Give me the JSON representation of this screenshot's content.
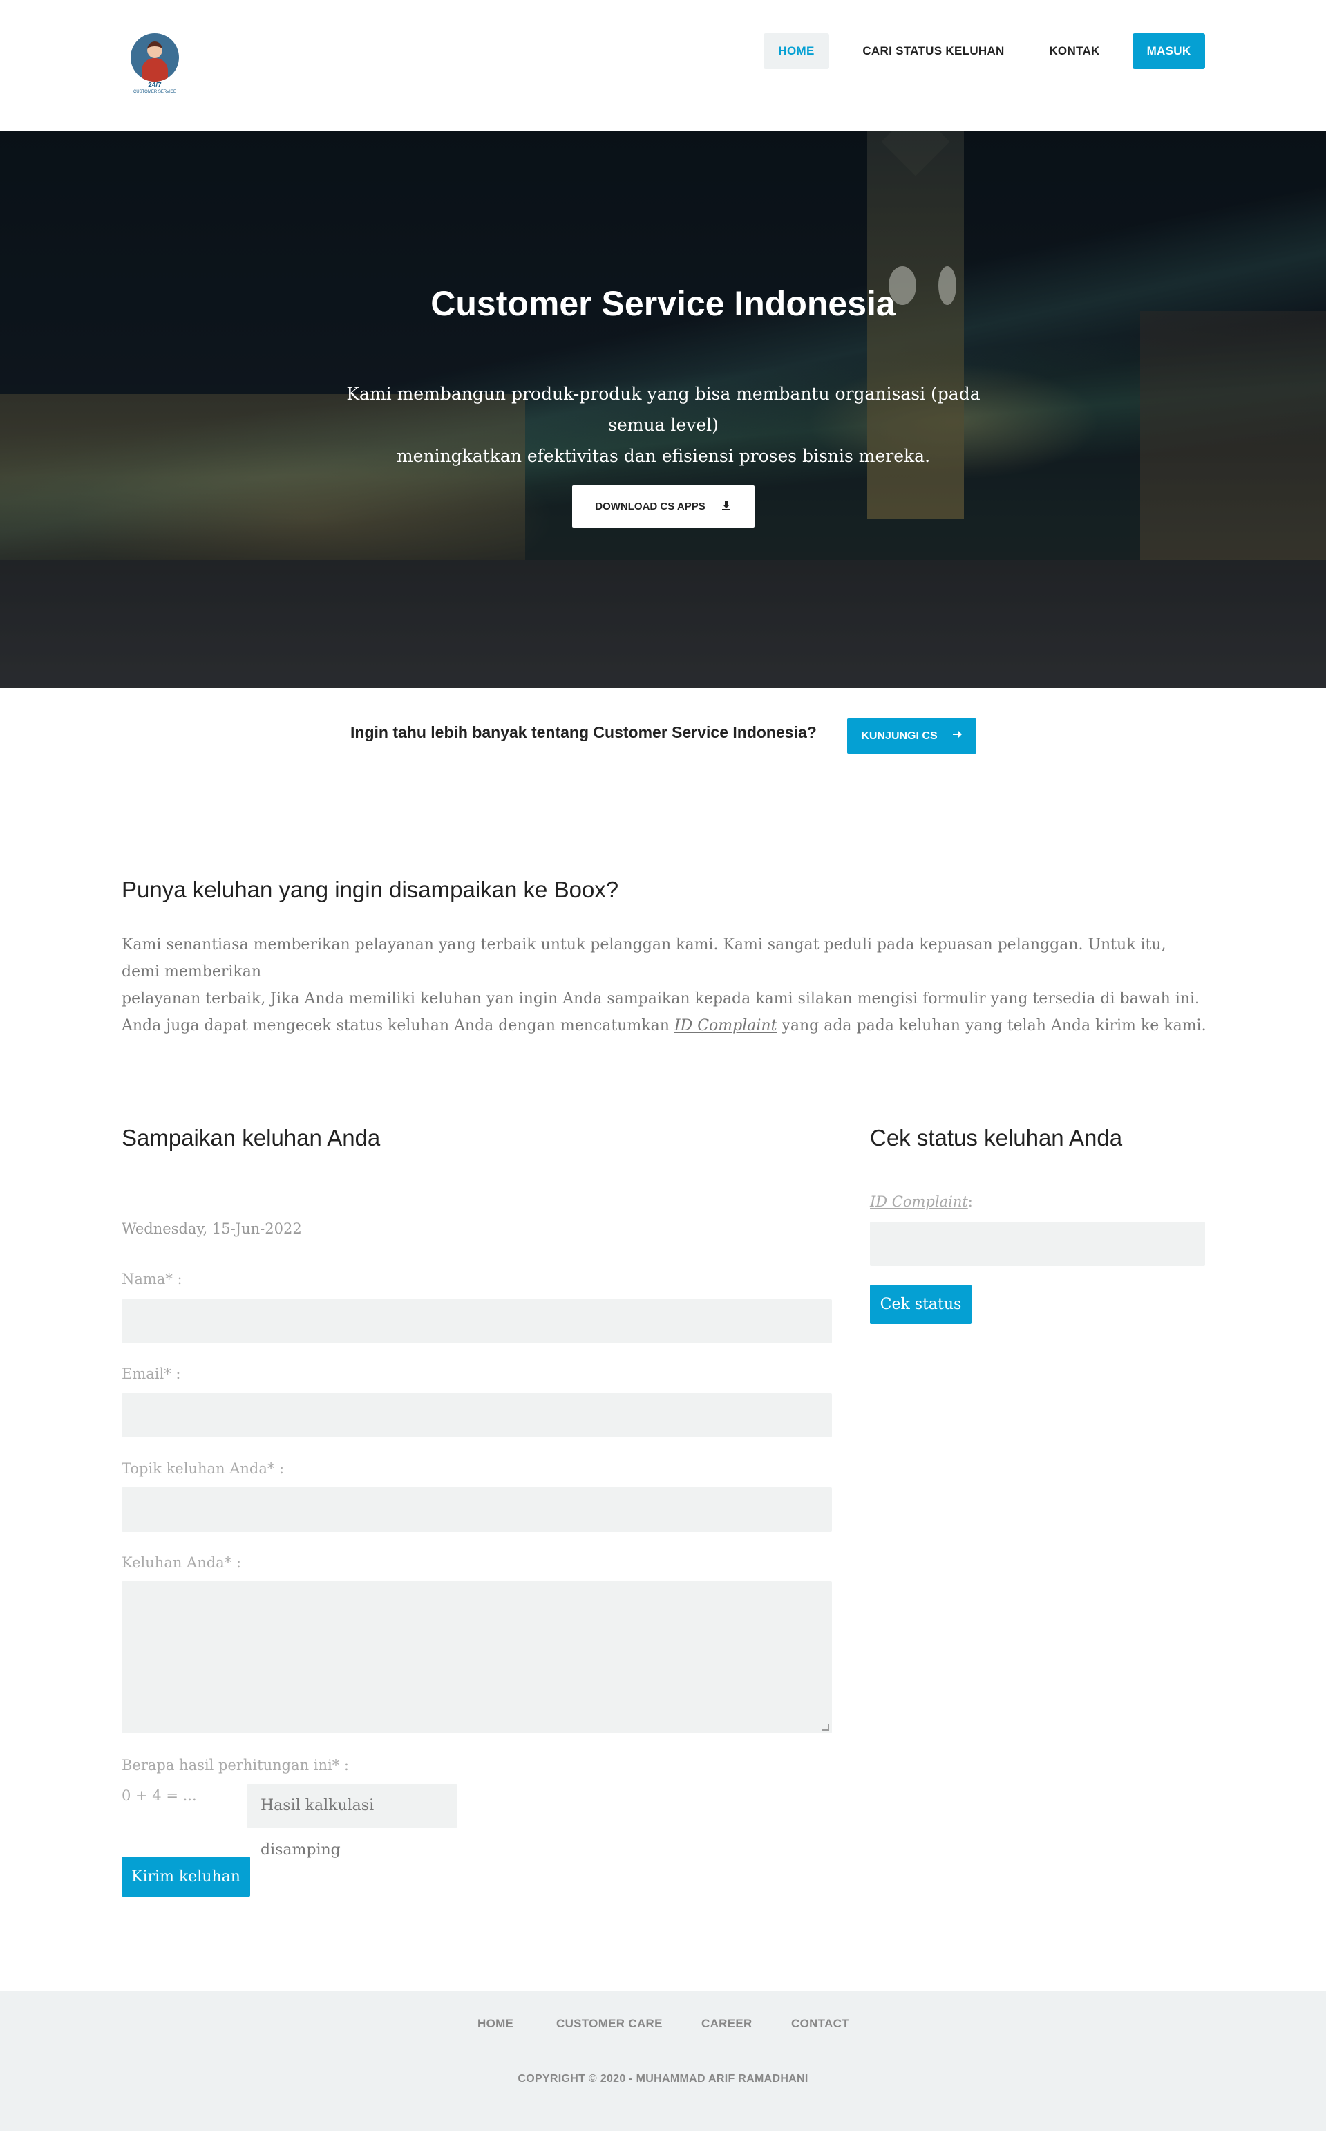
{
  "header": {
    "logo_text": "24/7",
    "logo_subtext": "CUSTOMER SERVICE",
    "nav": [
      {
        "label": "HOME",
        "active": true
      },
      {
        "label": "CARI STATUS KELUHAN",
        "active": false
      },
      {
        "label": "KONTAK",
        "active": false
      },
      {
        "label": "MASUK",
        "active": false
      }
    ]
  },
  "hero": {
    "title": "Customer Service Indonesia",
    "text_line1": "Kami membangun produk-produk yang bisa membantu organisasi (pada semua level)",
    "text_line2": "meningkatkan efektivitas dan efisiensi proses bisnis mereka.",
    "download_label": "DOWNLOAD CS APPS",
    "download_icon": "download-icon"
  },
  "cta": {
    "text": "Ingin tahu lebih banyak tentang Customer Service Indonesia?",
    "button_label": "KUNJUNGI CS",
    "button_icon": "arrow-right-icon"
  },
  "intro": {
    "title": "Punya keluhan yang ingin disampaikan ke Boox?",
    "p1_line1": "Kami senantiasa memberikan pelayanan yang terbaik untuk pelanggan kami. Kami sangat peduli pada kepuasan pelanggan. Untuk itu, demi memberikan",
    "p1_line2": "pelayanan terbaik, Jika Anda memiliki keluhan yan ingin Anda sampaikan kepada kami silakan mengisi formulir yang tersedia di bawah ini.",
    "p2_before": "Anda juga dapat mengecek status keluhan Anda dengan mencatumkan ",
    "p2_link": "ID Complaint",
    "p2_after": " yang ada pada keluhan yang telah Anda kirim ke kami."
  },
  "form": {
    "title": "Sampaikan keluhan Anda",
    "date": "Wednesday, 15-Jun-2022",
    "nama_label": "Nama* :",
    "nama_value": "",
    "email_label": "Email* :",
    "email_value": "",
    "topik_label": "Topik keluhan Anda* :",
    "topik_value": "",
    "keluhan_label": "Keluhan Anda* :",
    "keluhan_value": "",
    "calc_label": "Berapa hasil perhitungan ini* :",
    "calc_question": "0 + 4 = ...",
    "calc_placeholder": "Hasil kalkulasi disamping",
    "submit_label": "Kirim keluhan"
  },
  "status": {
    "title": "Cek status keluhan Anda",
    "id_label": "ID Complaint",
    "id_label_suffix": ":",
    "id_value": "",
    "button_label": "Cek status"
  },
  "footer": {
    "links": [
      "HOME",
      "CUSTOMER CARE",
      "CAREER",
      "CONTACT"
    ],
    "copyright": "COPYRIGHT © 2020 - MUHAMMAD ARIF RAMADHANI"
  },
  "colors": {
    "accent": "#05a0d3",
    "field_bg": "#f0f2f2",
    "footer_bg": "#eef1f2"
  }
}
